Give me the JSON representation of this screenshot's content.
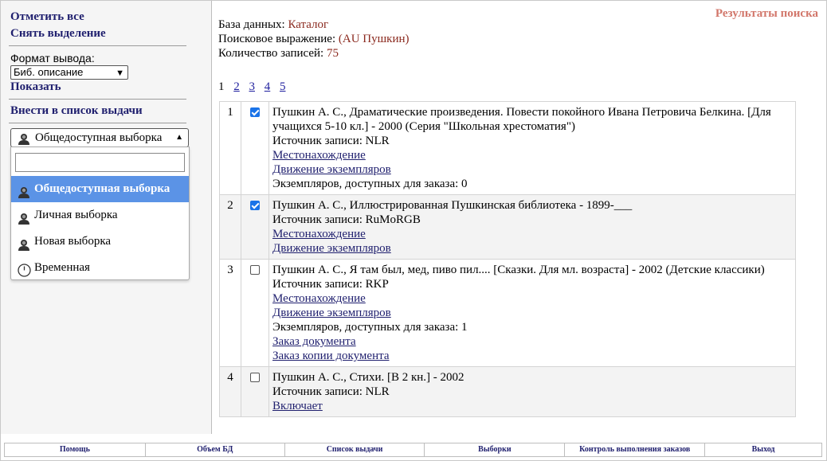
{
  "sidebar": {
    "select_all": "Отметить все",
    "deselect": "Снять выделение",
    "format_label": "Формат вывода:",
    "format_value": "Биб. описание",
    "show": "Показать",
    "add_to_list": "Внести в список выдачи",
    "selection_current": "Общедоступная выборка",
    "selection_options": [
      {
        "label": "Общедоступная выборка",
        "icon": "user-icon"
      },
      {
        "label": "Личная выборка",
        "icon": "user-icon"
      },
      {
        "label": "Новая выборка",
        "icon": "user-icon"
      },
      {
        "label": "Временная",
        "icon": "clock-icon"
      }
    ]
  },
  "main": {
    "results_title": "Результаты поиска",
    "db_label": "База данных:",
    "db_value": "Каталог",
    "query_label": "Поисковое выражение:",
    "query_value": "(AU Пушкин)",
    "count_label": "Количество записей:",
    "count_value": "75",
    "current_page": "1",
    "pages": [
      "2",
      "3",
      "4",
      "5"
    ]
  },
  "records": [
    {
      "num": "1",
      "checked": true,
      "title": "Пушкин А. С., Драматические произведения. Повести покойного Ивана Петровича Белкина. [Для учащихся 5-10 кл.] - 2000 (Серия \"Школьная хрестоматия\")",
      "source": "Источник записи: NLR",
      "links": [
        "Местонахождение",
        "Движение экземпляров"
      ],
      "available": "Экземпляров, доступных для заказа: 0",
      "links2": []
    },
    {
      "num": "2",
      "checked": true,
      "title": "Пушкин А. С., Иллюстрированная Пушкинская библиотека - 1899-___",
      "source": "Источник записи: RuMoRGB",
      "links": [
        "Местонахождение",
        "Движение экземпляров"
      ],
      "available": "",
      "links2": []
    },
    {
      "num": "3",
      "checked": false,
      "title": "Пушкин А. С., Я там был, мед, пиво пил.... [Сказки. Для мл. возраста] - 2002 (Детские классики)",
      "source": "Источник записи: RKP",
      "links": [
        "Местонахождение",
        "Движение экземпляров"
      ],
      "available": "Экземпляров, доступных для заказа: 1",
      "links2": [
        "Заказ документа",
        "Заказ копии документа"
      ]
    },
    {
      "num": "4",
      "checked": false,
      "title": "Пушкин А. С., Стихи. [В 2 кн.] - 2002",
      "source": "Источник записи: NLR",
      "links": [
        "Включает"
      ],
      "available": "",
      "links2": []
    }
  ],
  "footer": [
    "Помощь",
    "Объем БД",
    "Список выдачи",
    "Выборки",
    "Контроль выполнения заказов",
    "Выход"
  ],
  "colors": {
    "link": "#1f1f6e",
    "value_red": "#8b2a1f",
    "results_title": "#d2776b",
    "highlight": "#5b93e6"
  }
}
